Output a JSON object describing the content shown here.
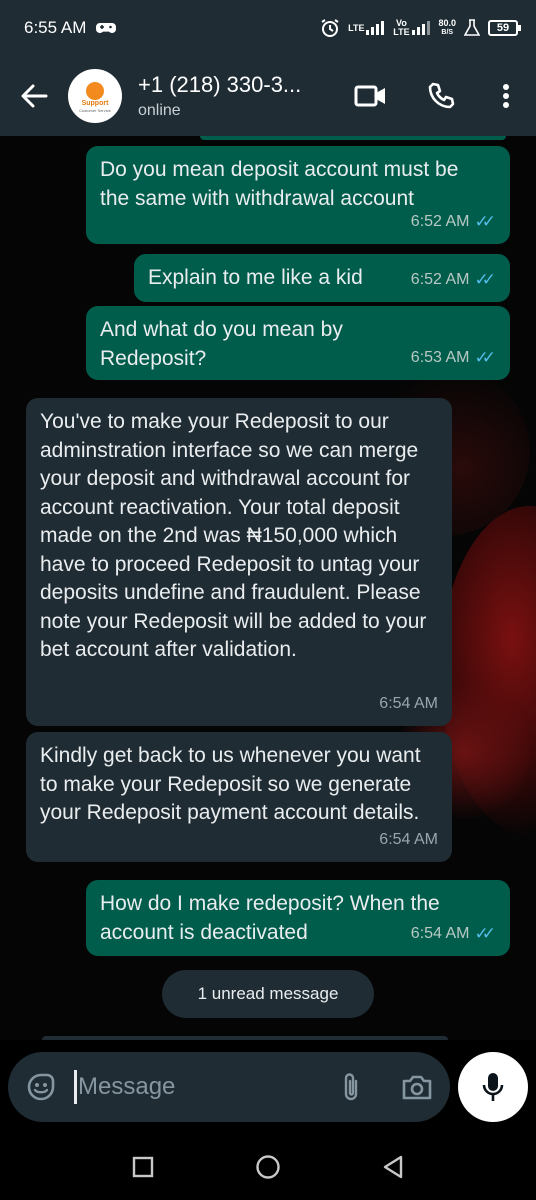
{
  "status_bar": {
    "time": "6:55 AM",
    "lte1": "LTE",
    "lte2": "Vo LTE",
    "speed": "80.0",
    "speed_unit": "B/S",
    "battery": "59"
  },
  "header": {
    "contact_name": "+1 (218) 330-3...",
    "status": "online",
    "avatar_text": "Support",
    "avatar_subtext": "Customer Service"
  },
  "messages": [
    {
      "direction": "out",
      "text": "Do you mean deposit account must be the same with withdrawal account",
      "time": "6:52 AM",
      "read": true
    },
    {
      "direction": "out",
      "text": "Explain to me like a kid",
      "time": "6:52 AM",
      "read": true
    },
    {
      "direction": "out",
      "text": "And what do you mean by Redeposit?",
      "time": "6:53 AM",
      "read": true
    },
    {
      "direction": "in",
      "text": "You've to make your Redeposit to our adminstration interface so we can merge your deposit and withdrawal account for account reactivation. Your total deposit made on the 2nd was ₦150,000 which have to proceed Redeposit to untag your deposits undefine and fraudulent. Please note your Redeposit will be added to your bet account after validation.",
      "time": "6:54 AM"
    },
    {
      "direction": "in",
      "text": "Kindly get back to us whenever you want to make your Redeposit so we generate your Redeposit payment account details.",
      "time": "6:54 AM"
    },
    {
      "direction": "out",
      "text": "How do I make redeposit? When the account is deactivated",
      "time": "6:54 AM",
      "read": true
    }
  ],
  "unread_banner": "1 unread message",
  "composer": {
    "placeholder": "Message"
  },
  "icons": {
    "back": "arrow-left-icon",
    "video": "video-call-icon",
    "call": "phone-icon",
    "menu": "more-vert-icon",
    "emoji": "emoji-icon",
    "attach": "paperclip-icon",
    "camera": "camera-icon",
    "mic": "mic-icon"
  },
  "colors": {
    "outgoing_bubble": "#005c4b",
    "incoming_bubble": "#202c33",
    "header_bg": "#1f2c34",
    "read_ticks": "#53bdeb"
  }
}
